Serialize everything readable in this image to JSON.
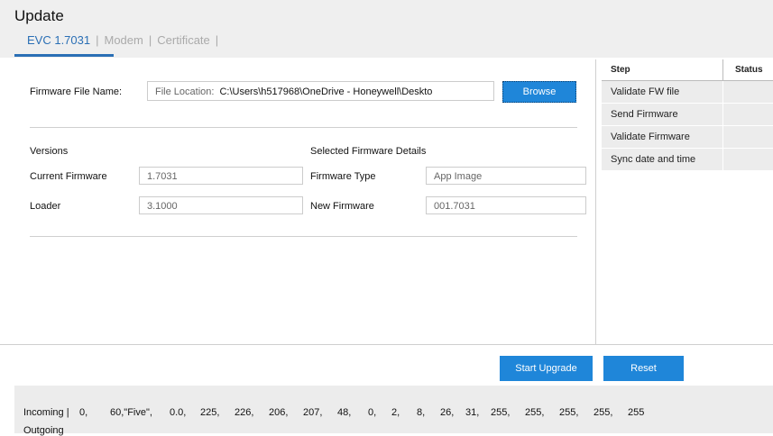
{
  "header": {
    "title": "Update",
    "tabs": [
      {
        "label": "EVC 1.7031",
        "active": true
      },
      {
        "label": "Modem",
        "active": false
      },
      {
        "label": "Certificate",
        "active": false
      }
    ],
    "tab_separator": "|"
  },
  "firmware_file": {
    "label": "Firmware File Name:",
    "location_prefix": "File Location:",
    "path": "C:\\Users\\h517968\\OneDrive - Honeywell\\Deskto",
    "browse_label": "Browse"
  },
  "versions": {
    "heading": "Versions",
    "current_firmware_label": "Current Firmware",
    "current_firmware_value": "1.7031",
    "loader_label": "Loader",
    "loader_value": "3.1000"
  },
  "selected_firmware": {
    "heading": "Selected Firmware Details",
    "type_label": "Firmware Type",
    "type_value": "App Image",
    "new_label": "New Firmware",
    "new_value": "001.7031"
  },
  "steps_table": {
    "headers": {
      "step": "Step",
      "status": "Status"
    },
    "rows": [
      {
        "step": "Validate FW file",
        "status": ""
      },
      {
        "step": "Send Firmware",
        "status": ""
      },
      {
        "step": "Validate Firmware",
        "status": ""
      },
      {
        "step": "Sync date and time",
        "status": ""
      }
    ]
  },
  "actions": {
    "start_label": "Start Upgrade",
    "reset_label": "Reset"
  },
  "log": {
    "incoming_label": "Incoming |",
    "incoming_values": [
      "0,",
      "60,\"Five\",",
      "0.0,",
      "225,",
      "226,",
      "206,",
      "207,",
      "48,",
      "0,",
      "2,",
      "8,",
      "26,",
      "31,",
      "255,",
      "255,",
      "255,",
      "255,",
      "255"
    ],
    "outgoing_label": "Outgoing"
  },
  "colors": {
    "accent": "#2a6fb5",
    "button": "#1f86d9",
    "header_bg": "#efefef",
    "row_bg": "#ececec"
  }
}
